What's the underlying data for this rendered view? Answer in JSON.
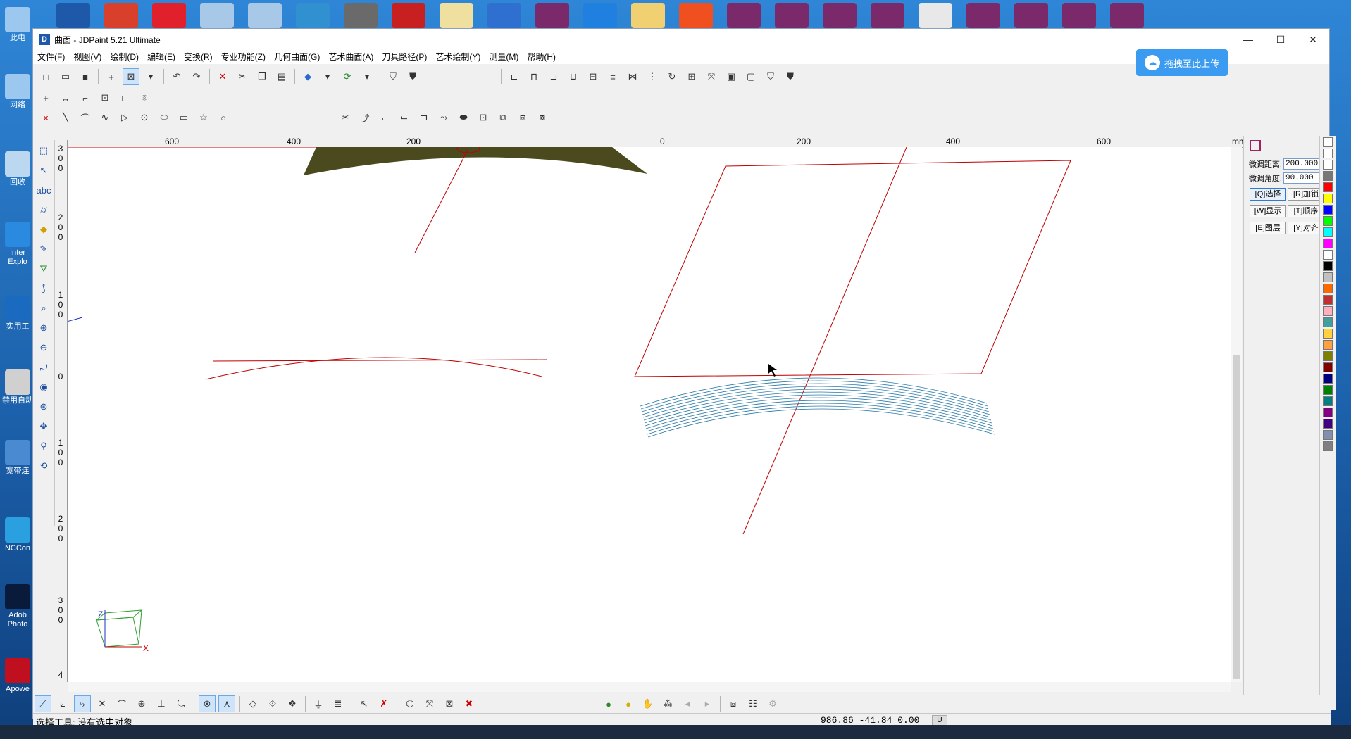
{
  "window": {
    "title": "曲面 - JDPaint 5.21 Ultimate",
    "app_icon": "jd",
    "minimize": "—",
    "maximize": "☐",
    "close": "✕"
  },
  "menu": [
    "文件(F)",
    "视图(V)",
    "绘制(D)",
    "编辑(E)",
    "变换(R)",
    "专业功能(Z)",
    "几何曲面(G)",
    "艺术曲面(A)",
    "刀具路径(P)",
    "艺术绘制(Y)",
    "测量(M)",
    "帮助(H)"
  ],
  "upload_button": "拖拽至此上传",
  "ruler": {
    "unit": "mm",
    "h_labels": [
      "600",
      "400",
      "200",
      "0",
      "200",
      "400",
      "600"
    ],
    "v_labels": [
      "3",
      "0",
      "0",
      "2",
      "0",
      "0",
      "1",
      "0",
      "0",
      "0",
      "1",
      "0",
      "0",
      "2",
      "0",
      "0",
      "3",
      "0",
      "0",
      "4"
    ]
  },
  "right_panel": {
    "field1_label": "微调距离:",
    "field1_value": "200.000",
    "field2_label": "微调角度:",
    "field2_value": "90.000",
    "buttons": [
      "[Q]选择",
      "[R]加锁",
      "[W]显示",
      "[T]顺序",
      "[E]图层",
      "[Y]对齐"
    ]
  },
  "palette": [
    "#ff0000",
    "#ffff00",
    "#0000ff",
    "#00ff00",
    "#00ffff",
    "#ff00ff",
    "#ffffff",
    "#000000",
    "#c0c0c0",
    "#ff6a00",
    "#c03030",
    "#ffb0c0",
    "#40a0a0",
    "#ffd040",
    "#ffa040",
    "#808000",
    "#800000",
    "#000080",
    "#008000",
    "#008080",
    "#800080",
    "#400080",
    "#8090b0",
    "#808080"
  ],
  "axis": {
    "z": "Z",
    "x": "X"
  },
  "status": {
    "text": "选择工具: 没有选中对象",
    "coords": "986.86 -41.84 0.00",
    "mode": "U"
  },
  "desktop_left_labels": [
    "此电",
    "网络",
    "回收",
    "Inter Explo",
    "实用工",
    "禁用自动",
    "宽带连",
    "NCCon",
    "Adob Photo",
    "Apowe"
  ]
}
